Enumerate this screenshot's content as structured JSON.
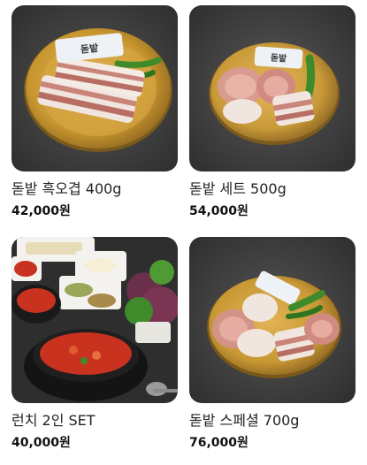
{
  "products": [
    {
      "name": "돋밭 흑오겹 400g",
      "price": "42,000원",
      "image_label": "돋밭"
    },
    {
      "name": "돋밭 세트 500g",
      "price": "54,000원",
      "image_label": "돋밭"
    },
    {
      "name": "런치 2인 SET",
      "price": "40,000원"
    },
    {
      "name": "돋밭 스페셜 700g",
      "price": "76,000원"
    }
  ],
  "colors": {
    "slate": "#3a3a3a",
    "brass_plate": "#c89a3c",
    "pork_fat": "#f1e6df",
    "pork_meat": "#c9857a",
    "pepper_green": "#3f8a2a",
    "stew_red": "#c8321e",
    "price_text": "#111111"
  }
}
